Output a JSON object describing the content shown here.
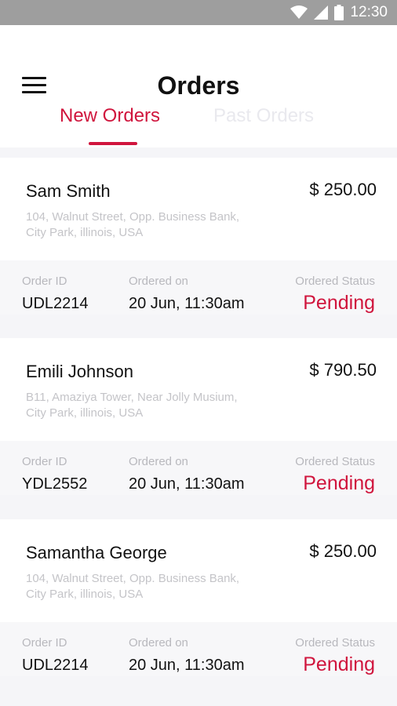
{
  "status_bar": {
    "time": "12:30",
    "icons": [
      "wifi-icon",
      "signal-icon",
      "battery-icon"
    ]
  },
  "header": {
    "title": "Orders",
    "menu_icon": "hamburger-menu-icon"
  },
  "tabs": [
    {
      "label": "New Orders",
      "active": true
    },
    {
      "label": "Past Orders",
      "active": false
    }
  ],
  "labels": {
    "order_id": "Order ID",
    "ordered_on": "Ordered on",
    "ordered_status": "Ordered Status"
  },
  "orders": [
    {
      "name": "Sam Smith",
      "amount": "$ 250.00",
      "address_line1": "104, Walnut Street, Opp. Business Bank,",
      "address_line2": "City Park, illinois, USA",
      "order_id": "UDL2214",
      "date": "20 Jun, 11:30am",
      "status": "Pending"
    },
    {
      "name": "Emili Johnson",
      "amount": "$ 790.50",
      "address_line1": "B11, Amaziya Tower,  Near Jolly Musium,",
      "address_line2": "City Park, illinois, USA",
      "order_id": "YDL2552",
      "date": "20 Jun, 11:30am",
      "status": "Pending"
    },
    {
      "name": "Samantha George",
      "amount": "$ 250.00",
      "address_line1": "104, Walnut Street, Opp. Business Bank,",
      "address_line2": "City Park, illinois, USA",
      "order_id": "UDL2214",
      "date": "20 Jun, 11:30am",
      "status": "Pending"
    }
  ],
  "colors": {
    "accent": "#d0153d",
    "status_bar": "#9e9e9e",
    "muted_text": "#c4c4c8",
    "background": "#f5f5f8"
  }
}
